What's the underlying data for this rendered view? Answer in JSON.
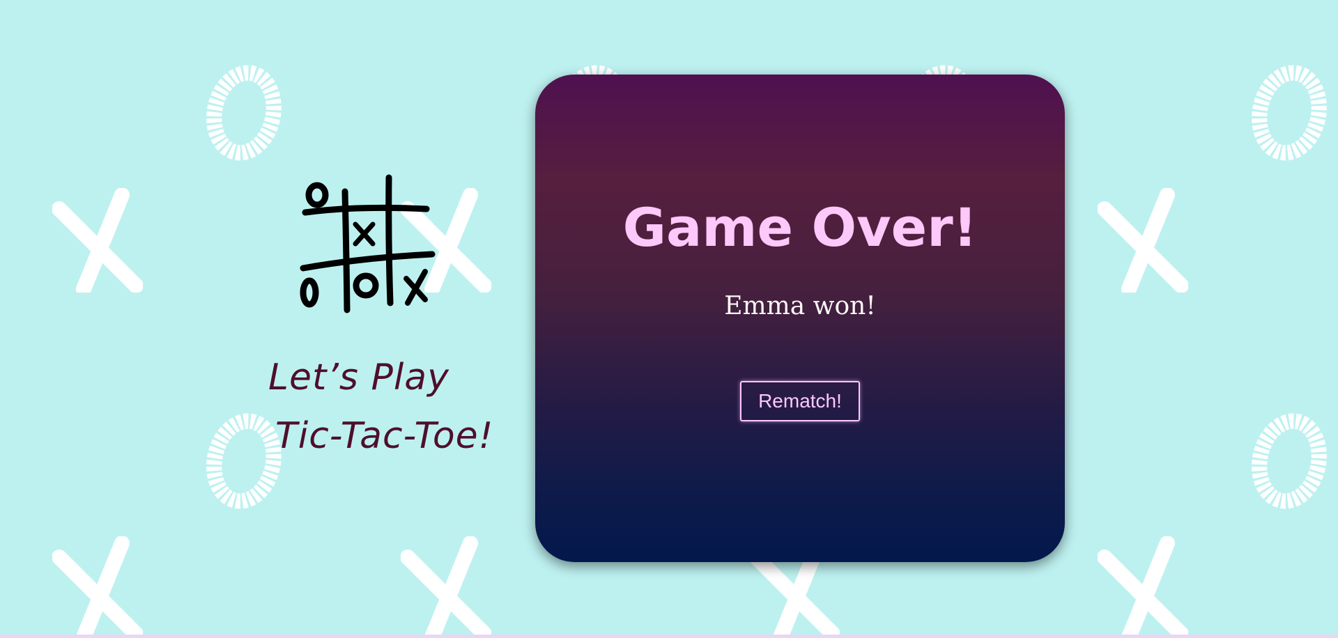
{
  "page": {
    "background_color": "#bdf1f0",
    "pattern_color": "#ffffff"
  },
  "branding": {
    "logo_icon": "tic-tac-toe-grid-icon",
    "tagline_line1": "Let’s Play",
    "tagline_line2": "Tic-Tac-Toe!",
    "tagline_color": "#4e0f2b"
  },
  "game_over": {
    "title": "Game Over!",
    "message": "Emma won!",
    "rematch_label": "Rematch!",
    "title_color": "#fdc8fa",
    "message_color": "#fff6f6"
  }
}
